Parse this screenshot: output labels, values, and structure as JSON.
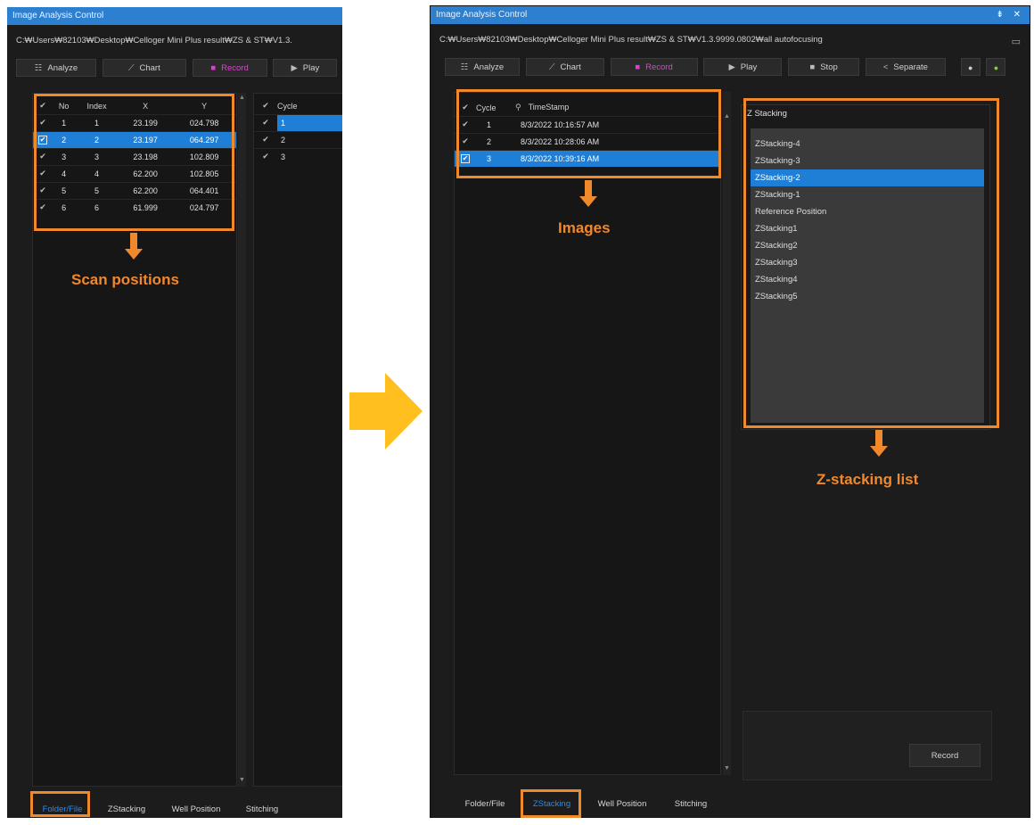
{
  "left": {
    "title": "Image Analysis Control",
    "path": "C:₩Users₩82103₩Desktop₩Celloger Mini Plus result₩ZS & ST₩V1.3.",
    "toolbar": {
      "analyze": "Analyze",
      "chart": "Chart",
      "record": "Record",
      "play": "Play"
    },
    "scan_table": {
      "columns": [
        "No",
        "Index",
        "X",
        "Y"
      ],
      "rows": [
        [
          "1",
          "1",
          "23.199",
          "024.798"
        ],
        [
          "2",
          "2",
          "23.197",
          "064.297"
        ],
        [
          "3",
          "3",
          "23.198",
          "102.809"
        ],
        [
          "4",
          "4",
          "62.200",
          "102.805"
        ],
        [
          "5",
          "5",
          "62.200",
          "064.401"
        ],
        [
          "6",
          "6",
          "61.999",
          "024.797"
        ]
      ],
      "selected_row": 1
    },
    "cycle_table": {
      "column": "Cycle",
      "rows": [
        "1",
        "2",
        "3"
      ]
    },
    "tabs": [
      "Folder/File",
      "ZStacking",
      "Well Position",
      "Stitching"
    ],
    "active_tab": 0
  },
  "right": {
    "title": "Image Analysis Control",
    "win_buttons": "⇟ ✕",
    "path": "C:₩Users₩82103₩Desktop₩Celloger Mini Plus result₩ZS & ST₩V1.3.9999.0802₩all autofocusing",
    "toolbar": {
      "analyze": "Analyze",
      "chart": "Chart",
      "record": "Record",
      "play": "Play",
      "stop": "Stop",
      "separate": "Separate"
    },
    "images_table": {
      "columns": [
        "Cycle",
        "TimeStamp"
      ],
      "rows": [
        [
          "1",
          "8/3/2022 10:16:57 AM"
        ],
        [
          "2",
          "8/3/2022 10:28:06 AM"
        ],
        [
          "3",
          "8/3/2022 10:39:16 AM"
        ]
      ],
      "selected_row": 2
    },
    "zstack": {
      "header": "Z Stacking",
      "items": [
        "ZStacking-4",
        "ZStacking-3",
        "ZStacking-2",
        "ZStacking-1",
        "Reference Position",
        "ZStacking1",
        "ZStacking2",
        "ZStacking3",
        "ZStacking4",
        "ZStacking5"
      ],
      "selected": 2
    },
    "record_button": "Record",
    "tabs": [
      "Folder/File",
      "ZStacking",
      "Well Position",
      "Stitching"
    ],
    "active_tab": 1
  },
  "annotations": {
    "scan_positions": "Scan positions",
    "images": "Images",
    "zstacking_list": "Z-stacking list"
  },
  "colors": {
    "accent_orange": "#f0882c",
    "big_arrow": "#ffbf1f",
    "selection_blue": "#1f7fd6",
    "title_blue": "#2d7fd0"
  }
}
